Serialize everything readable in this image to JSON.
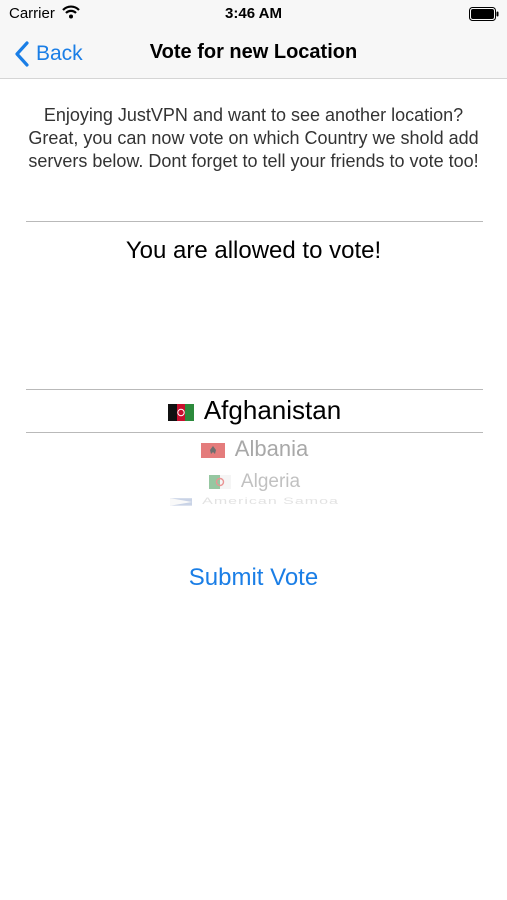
{
  "status_bar": {
    "carrier": "Carrier",
    "time": "3:46 AM",
    "wifi_icon": "wifi-icon",
    "battery_icon": "battery-icon"
  },
  "nav_bar": {
    "back_label": "Back",
    "back_icon": "chevron-left-icon",
    "title": "Vote for new Location"
  },
  "intro_text": "Enjoying JustVPN and want to see another location? Great, you can now vote on which Country we shold add servers below. Dont forget to tell your friends to vote too!",
  "vote_status": "You are allowed to vote!",
  "picker": {
    "selected": "Afghanistan",
    "items": [
      {
        "name": "Afghanistan",
        "flag_icon": "afghanistan-flag-icon"
      },
      {
        "name": "Albania",
        "flag_icon": "albania-flag-icon"
      },
      {
        "name": "Algeria",
        "flag_icon": "algeria-flag-icon"
      },
      {
        "name": "American Samoa",
        "flag_icon": "american-samoa-flag-icon"
      }
    ]
  },
  "submit_label": "Submit Vote",
  "colors": {
    "accent": "#1a7ee6",
    "bar_background": "#f7f7f7"
  }
}
